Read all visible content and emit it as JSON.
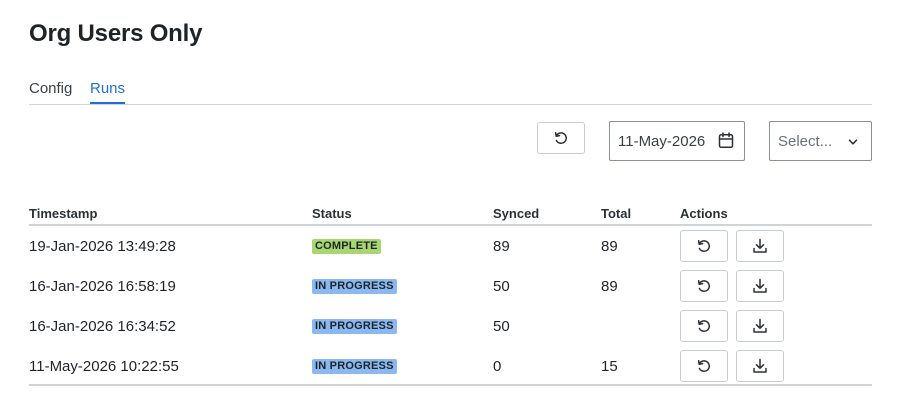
{
  "page": {
    "title": "Org Users Only"
  },
  "tabs": [
    {
      "label": "Config",
      "active": false
    },
    {
      "label": "Runs",
      "active": true
    }
  ],
  "toolbar": {
    "refresh_icon": "refresh-icon",
    "date_value": "11-May-2026",
    "date_icon": "calendar-icon",
    "select_placeholder": "Select...",
    "select_icon": "chevron-down-icon"
  },
  "table": {
    "columns": [
      "Timestamp",
      "Status",
      "Synced",
      "Total",
      "Actions"
    ],
    "rows": [
      {
        "timestamp": "19-Jan-2026 13:49:28",
        "status": "COMPLETE",
        "synced": "89",
        "total": "89"
      },
      {
        "timestamp": "16-Jan-2026 16:58:19",
        "status": "IN PROGRESS",
        "synced": "50",
        "total": "89"
      },
      {
        "timestamp": "16-Jan-2026 16:34:52",
        "status": "IN PROGRESS",
        "synced": "50",
        "total": ""
      },
      {
        "timestamp": "11-May-2026 10:22:55",
        "status": "IN PROGRESS",
        "synced": "0",
        "total": "15"
      }
    ]
  },
  "colors": {
    "accent": "#1f6fd6",
    "complete_badge": "#a7d770",
    "progress_badge": "#8ab8f0"
  }
}
